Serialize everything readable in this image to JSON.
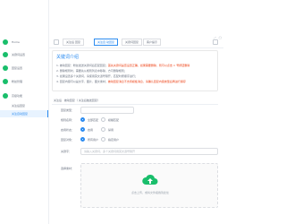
{
  "sidebar": {
    "items": [
      {
        "label": "Home"
      },
      {
        "label": "关键词设置"
      },
      {
        "label": "回复设置"
      },
      {
        "label": "粉丝管理"
      },
      {
        "label": "高级功能"
      }
    ],
    "sub_items": [
      {
        "label": "关注后回复"
      },
      {
        "label": "关注自动回复"
      }
    ]
  },
  "tabs": [
    {
      "label": "关注后 回复"
    },
    {
      "label": "关注自 动回复"
    },
    {
      "label": "关键词回复"
    },
    {
      "label": "客户提示"
    }
  ],
  "top_right": {
    "icons": [
      "expand-icon",
      "user-avatar"
    ]
  },
  "notice": {
    "title": "关键词介绍",
    "lines": [
      {
        "text": "1. 被动回复：粉丝发送关键词后匹配回复；",
        "red": "首先关键词是否设置正确，如果需要删除，则可以点击 × 号按钮删除"
      },
      {
        "text": "2. 删除规则时，需要先从规则列表中移除，方可删除规则；",
        "red": ""
      },
      {
        "text": "3. 如果设置多个关键词，请使用英文逗号隔开，匹配时按顺序进行；",
        "red": ""
      },
      {
        "text": "4. 回复内容可以是文字、图片、图文素材，",
        "red": "被动回复消息不支持模板消息，请确认回复内容类型后再进行保存"
      }
    ]
  },
  "form": {
    "header": "关注后 · 被动回复（ 关注后触发回复）",
    "fields": {
      "reply_type_label": "回复类型：",
      "reply_type_options": [
        "文本消息",
        "图文消息"
      ],
      "rule_name_label": "规则名称：",
      "rule_name_options": [
        "全部匹配",
        "模糊匹配"
      ],
      "status_label": "启用状态：",
      "status_options": [
        "启用",
        "禁用"
      ],
      "audience_label": "回复对象：",
      "audience_options": [
        "所有用户",
        "指定用户"
      ],
      "keyword_label": "关键字：",
      "keyword_placeholder": "请输入关键词，多个关键词用英文逗号隔开",
      "media_label": "选择素材：",
      "upload_text": "点击上传，或将文件拖拽到此处"
    }
  }
}
